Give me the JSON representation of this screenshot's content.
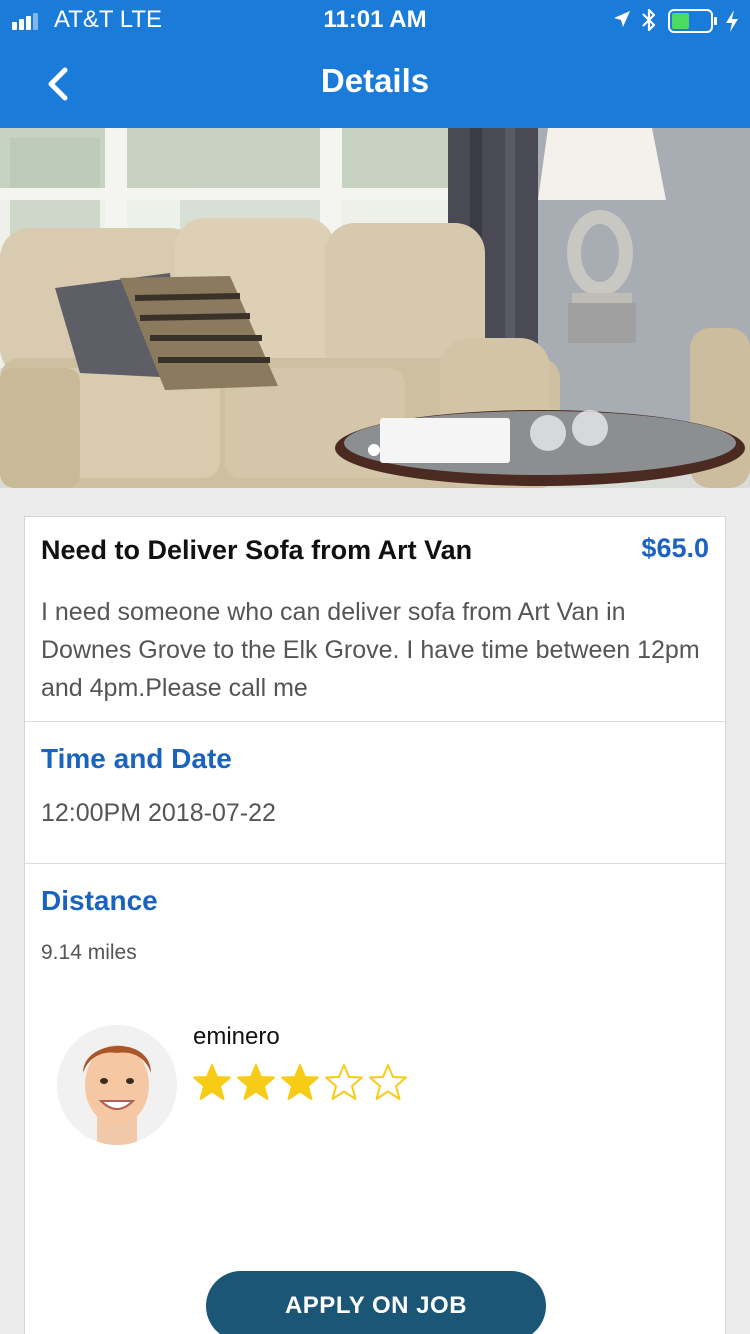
{
  "status_bar": {
    "carrier": "AT&T  LTE",
    "time": "11:01 AM",
    "battery_color": "#4cd964"
  },
  "nav": {
    "title": "Details",
    "back_icon": "chevron-left-icon"
  },
  "hero": {
    "image": "sofa-photo",
    "carousel_pages": 1,
    "carousel_current": 1
  },
  "job": {
    "title": "Need to Deliver Sofa from Art Van",
    "price": "$65.0",
    "description": "I need  someone who can deliver sofa from Art Van in Downes Grove to the Elk Grove. I have time between 12pm and 4pm.Please call me"
  },
  "time_section": {
    "title": "Time and Date",
    "value": "12:00PM 2018-07-22"
  },
  "distance_section": {
    "title": "Distance",
    "value": "9.14 miles"
  },
  "poster": {
    "username": "eminero",
    "rating": 3,
    "rating_max": 5
  },
  "apply_button": {
    "label": "APPLY ON JOB"
  },
  "colors": {
    "header": "#1a7bd8",
    "accent_text": "#1a64c0",
    "button": "#1b5677",
    "star": "#f7cc17"
  }
}
